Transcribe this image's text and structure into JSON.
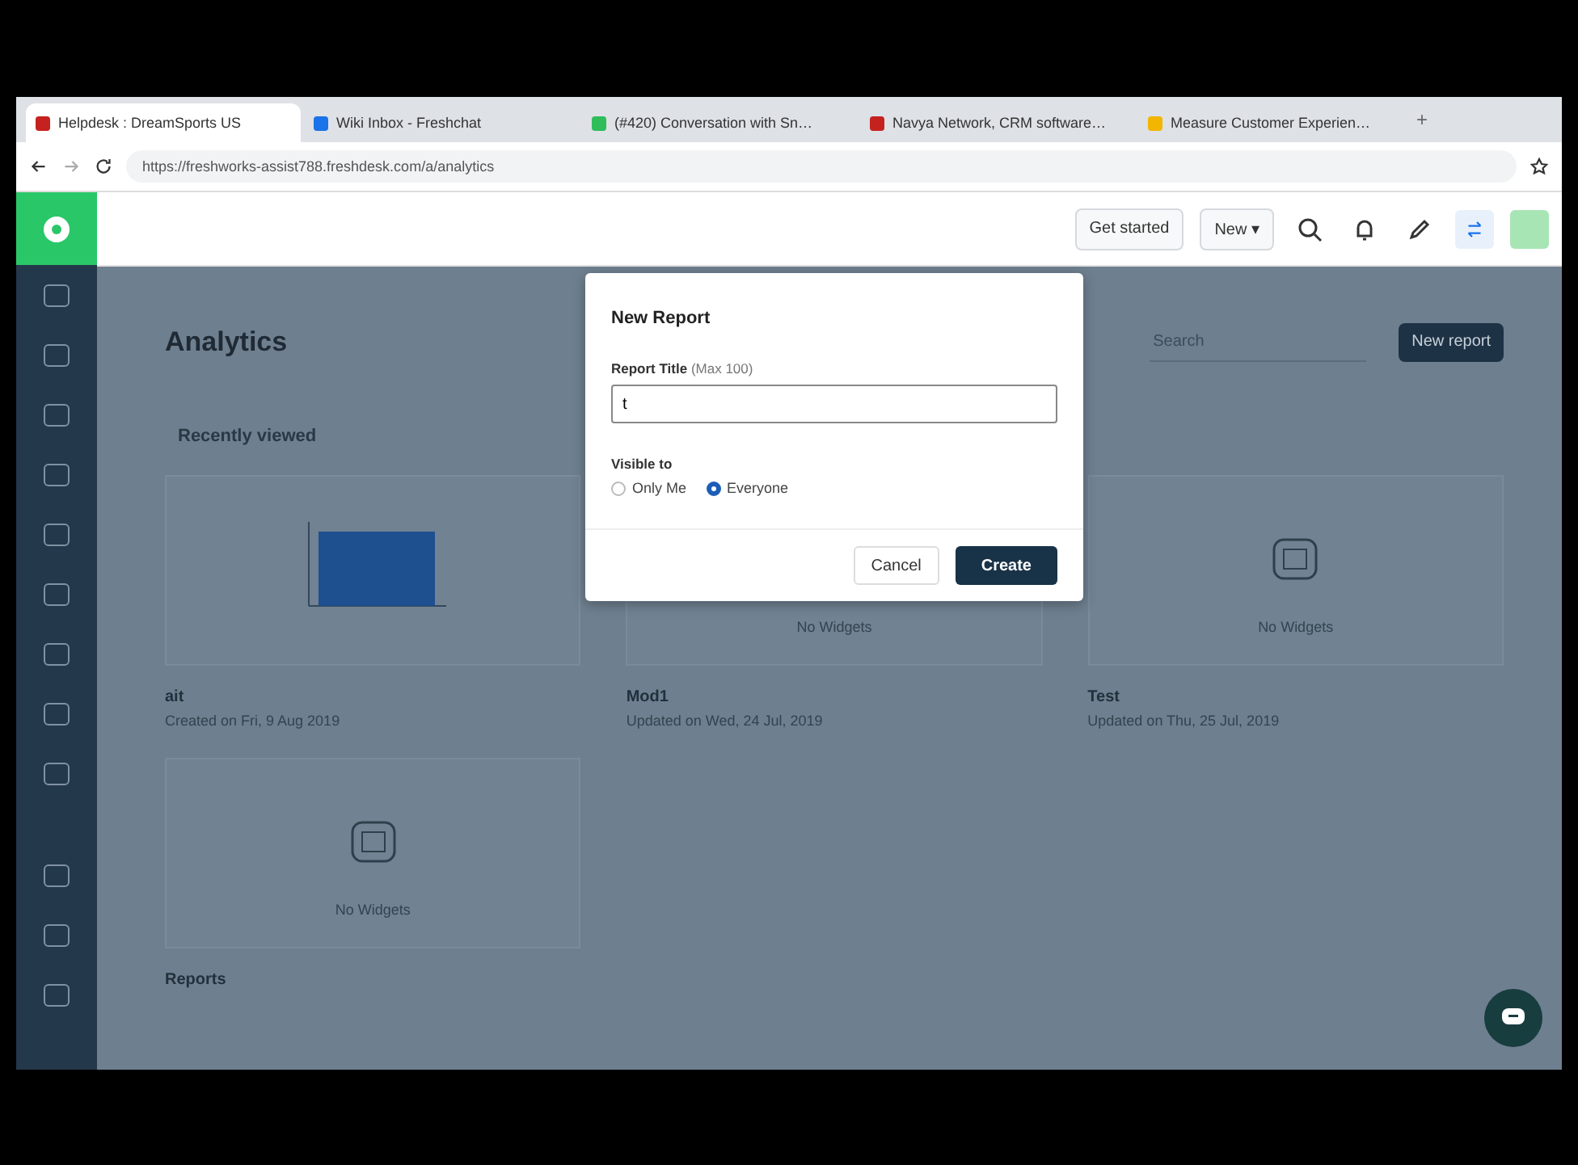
{
  "browser": {
    "tabs": [
      {
        "label": "Helpdesk : DreamSports US",
        "selected": true,
        "color": "#c5221f"
      },
      {
        "label": "Wiki Inbox - Freshchat",
        "selected": false,
        "color": "#1a73e8"
      },
      {
        "label": "(#420) Conversation with Sn…",
        "selected": false,
        "color": "#2ebd59"
      },
      {
        "label": "Navya Network, CRM software…",
        "selected": false,
        "color": "#c5221f"
      },
      {
        "label": "Measure Customer Experien…",
        "selected": false,
        "color": "#f2b600"
      }
    ],
    "new_tab": "+",
    "url": "https://freshworks-assist788.freshdesk.com/a/analytics"
  },
  "header": {
    "get_started": "Get started",
    "new_button": "New",
    "new_caret": "▾"
  },
  "page": {
    "title": "Analytics",
    "search_placeholder": "Search",
    "new_report": "New report",
    "section": "Recently viewed",
    "cards": [
      {
        "kind": "chart",
        "name": "ait",
        "meta": "Created on Fri, 9 Aug 2019"
      },
      {
        "kind": "empty",
        "empty_text": "No Widgets",
        "name": "Mod1",
        "meta": "Updated on Wed, 24 Jul, 2019"
      },
      {
        "kind": "empty",
        "empty_text": "No Widgets",
        "name": "Test",
        "meta": "Updated on Thu, 25 Jul, 2019"
      },
      {
        "kind": "empty",
        "empty_text": "No Widgets",
        "name": "Reports"
      }
    ]
  },
  "modal": {
    "title": "New Report",
    "field_label": "Report Title",
    "field_hint": "(Max 100)",
    "field_value": "t",
    "visible_label": "Visible to",
    "options": [
      {
        "label": "Only Me",
        "selected": false
      },
      {
        "label": "Everyone",
        "selected": true
      }
    ],
    "cancel": "Cancel",
    "create": "Create"
  }
}
